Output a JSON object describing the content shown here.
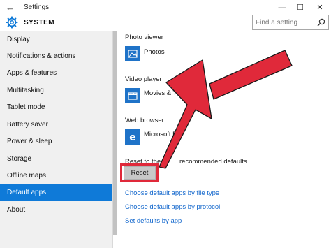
{
  "window": {
    "back_glyph": "←",
    "title": "Settings",
    "minimize_glyph": "—",
    "maximize_glyph": "☐",
    "close_glyph": "✕"
  },
  "header": {
    "title": "SYSTEM",
    "icon": "gear-icon"
  },
  "search": {
    "placeholder": "Find a setting",
    "icon": "search-icon"
  },
  "sidebar": {
    "items": [
      {
        "label": "Display",
        "active": false
      },
      {
        "label": "Notifications & actions",
        "active": false
      },
      {
        "label": "Apps & features",
        "active": false
      },
      {
        "label": "Multitasking",
        "active": false
      },
      {
        "label": "Tablet mode",
        "active": false
      },
      {
        "label": "Battery saver",
        "active": false
      },
      {
        "label": "Power & sleep",
        "active": false
      },
      {
        "label": "Storage",
        "active": false
      },
      {
        "label": "Offline maps",
        "active": false
      },
      {
        "label": "Default apps",
        "active": true
      },
      {
        "label": "About",
        "active": false
      }
    ],
    "active_color": "#0f7ad8"
  },
  "content": {
    "photo_viewer": {
      "label": "Photo viewer",
      "app": "Photos",
      "icon": "photos-icon"
    },
    "video_player": {
      "label": "Video player",
      "app": "Movies & TV",
      "icon": "movies-tv-icon"
    },
    "web_browser": {
      "label": "Web browser",
      "app": "Microsoft E",
      "icon": "edge-icon"
    },
    "reset": {
      "label_left": "Reset to the M",
      "label_right": "recommended defaults",
      "button": "Reset"
    },
    "links": [
      "Choose default apps by file type",
      "Choose default apps by protocol",
      "Set defaults by app"
    ]
  },
  "annotation": {
    "arrow_color": "#e0293a",
    "highlight_color": "#e0293a"
  }
}
